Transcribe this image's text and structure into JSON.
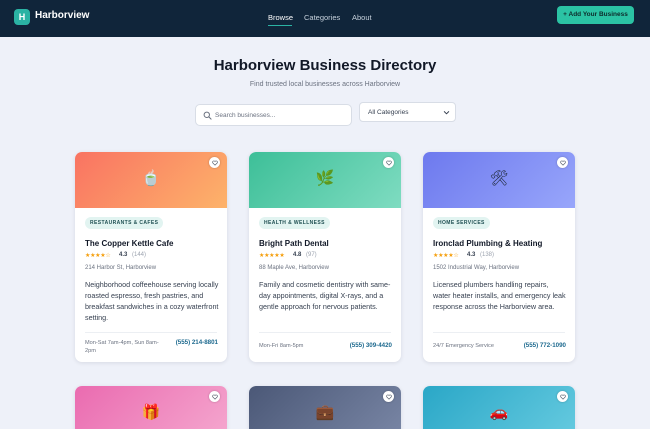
{
  "header": {
    "logo_letter": "H",
    "brand": "Harborview",
    "nav": [
      "Browse",
      "Categories",
      "About"
    ],
    "add_button": "+ Add Your Business"
  },
  "hero": {
    "title": "Harborview Business Directory",
    "subtitle": "Find trusted local businesses across Harborview"
  },
  "search": {
    "placeholder": "Search businesses...",
    "category_selected": "All Categories"
  },
  "colors": {
    "header_bg": "#10253a",
    "accent": "#2bc3a4",
    "phone": "#1e6a8f",
    "star": "#f59e0b"
  },
  "cards": [
    {
      "category": "RESTAURANTS & CAFES",
      "name": "The Copper Kettle Cafe",
      "stars": "★★★★☆",
      "rating": "4.3",
      "reviews": "(144)",
      "address": "214 Harbor St, Harborview",
      "description": "Neighborhood coffeehouse serving locally roasted espresso, fresh pastries, and breakfast sandwiches in a cozy waterfront setting.",
      "hours": "Mon-Sat 7am-4pm, Sun 8am-2pm",
      "phone": "(555) 214-8801",
      "icon": "kettle-icon",
      "emoji": "🍵",
      "gradient": [
        "#f97362",
        "#fdb36a"
      ]
    },
    {
      "category": "HEALTH & WELLNESS",
      "name": "Bright Path Dental",
      "stars": "★★★★★",
      "rating": "4.8",
      "reviews": "(97)",
      "address": "88 Maple Ave, Harborview",
      "description": "Family and cosmetic dentistry with same-day appointments, digital X-rays, and a gentle approach for nervous patients.",
      "hours": "Mon-Fri 8am-5pm",
      "phone": "(555) 309-4420",
      "icon": "leaf-icon",
      "emoji": "🌿",
      "gradient": [
        "#3dbf98",
        "#7fdcc1"
      ]
    },
    {
      "category": "HOME SERVICES",
      "name": "Ironclad Plumbing & Heating",
      "stars": "★★★★☆",
      "rating": "4.3",
      "reviews": "(138)",
      "address": "1502 Industrial Way, Harborview",
      "description": "Licensed plumbers handling repairs, water heater installs, and emergency leak response across the Harborview area.",
      "hours": "24/7 Emergency Service",
      "phone": "(555) 772-1090",
      "icon": "tools-icon",
      "emoji": "🛠",
      "gradient": [
        "#6d79ee",
        "#98a6fb"
      ]
    },
    {
      "icon": "gift-icon",
      "emoji": "🎁",
      "gradient": [
        "#ea6bb0",
        "#f5a8cf"
      ]
    },
    {
      "icon": "briefcase-icon",
      "emoji": "💼",
      "gradient": [
        "#4b5877",
        "#7a87a6"
      ]
    },
    {
      "icon": "car-icon",
      "emoji": "🚗",
      "gradient": [
        "#2aa7c7",
        "#67cbe0"
      ]
    }
  ]
}
